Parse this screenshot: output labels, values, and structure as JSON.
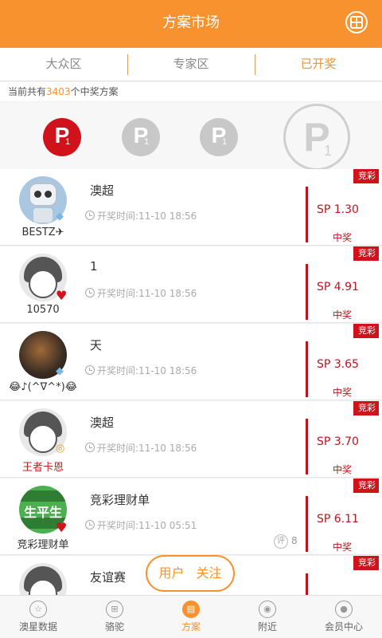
{
  "header": {
    "title": "方案市场"
  },
  "tabs": [
    {
      "label": "大众区"
    },
    {
      "label": "专家区"
    },
    {
      "label": "已开奖"
    }
  ],
  "summary": {
    "prefix": "当前共有",
    "count": "3403",
    "suffix": "个中奖方案"
  },
  "podium": {
    "badge_letter": "P",
    "badge_sub": "1"
  },
  "plans": [
    {
      "user": "BESTZ✈",
      "title": "澳超",
      "time": "开奖时间:11-10 18:56",
      "sp": "SP 1.30",
      "result": "中奖",
      "tag": "竞彩",
      "avatar": "robot",
      "badge": "diamond"
    },
    {
      "user": "10570",
      "title": "1",
      "time": "开奖时间:11-10 18:56",
      "sp": "SP 4.91",
      "result": "中奖",
      "tag": "竞彩",
      "avatar": "girl",
      "badge": "heart"
    },
    {
      "user": "😂♪(^∇^*)😂",
      "title": "天",
      "time": "开奖时间:11-10 18:56",
      "sp": "SP 3.65",
      "result": "中奖",
      "tag": "竞彩",
      "avatar": "dark",
      "badge": "diamond"
    },
    {
      "user": "王者卡恩",
      "title": "澳超",
      "time": "开奖时间:11-10 18:56",
      "sp": "SP 3.70",
      "result": "中奖",
      "tag": "竞彩",
      "avatar": "girl",
      "badge": "ring"
    },
    {
      "user": "竞彩理财单",
      "title": "竞彩理财单",
      "time": "开奖时间:11-10 05:51",
      "sp": "SP 6.11",
      "result": "中奖",
      "tag": "竞彩",
      "avatar": "green",
      "badge": "heart",
      "comment_icon": "评",
      "comments": "8"
    },
    {
      "user": "",
      "title": "友谊赛",
      "time": "",
      "sp": "",
      "result": "",
      "tag": "竞彩",
      "avatar": "girl",
      "badge": ""
    }
  ],
  "follow_pill": {
    "text": "用户 关注"
  },
  "green_avatar_text": "生平生",
  "bottom_nav": [
    {
      "label": "澳星数据",
      "icon": "star-icon"
    },
    {
      "label": "骆驼",
      "icon": "cart-icon"
    },
    {
      "label": "方案",
      "icon": "document-icon",
      "active": true
    },
    {
      "label": "附近",
      "icon": "location-pin-icon"
    },
    {
      "label": "会员中心",
      "icon": "user-icon"
    }
  ],
  "colors": {
    "brand": "#f7922e",
    "accent_red": "#c0121b"
  }
}
